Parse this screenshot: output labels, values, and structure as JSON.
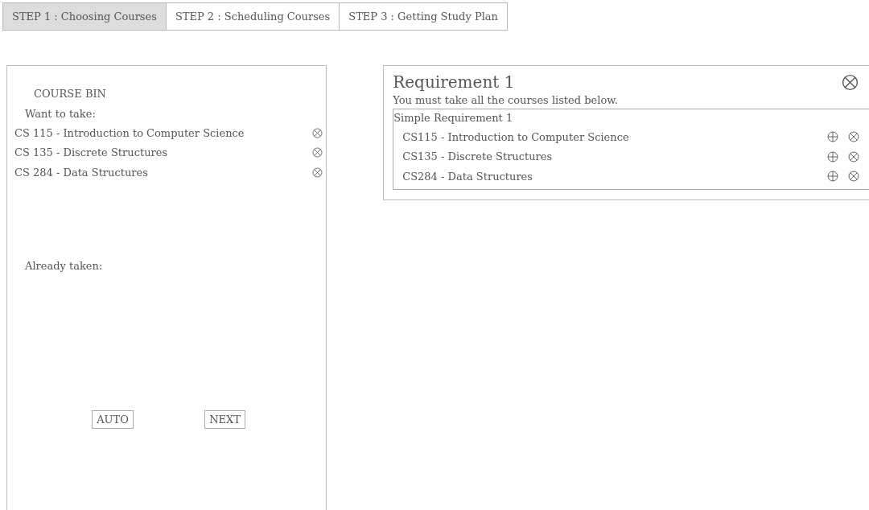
{
  "tabs": [
    {
      "label": "STEP 1 : Choosing Courses",
      "selected": true
    },
    {
      "label": "STEP 2 : Scheduling Courses",
      "selected": false
    },
    {
      "label": "STEP 3 : Getting Study Plan",
      "selected": false
    }
  ],
  "course_bin": {
    "title": "COURSE BIN",
    "want_label": "Want to take:",
    "want_courses": [
      "CS 115 - Introduction to Computer Science",
      "CS 135 - Discrete Structures",
      "CS 284 - Data Structures"
    ],
    "taken_label": "Already taken:",
    "buttons": [
      "AUTO",
      "NEXT"
    ]
  },
  "requirement": {
    "title": "Requirement 1",
    "description": "You must take all the courses listed below.",
    "group": {
      "title": "Simple Requirement 1",
      "courses": [
        "CS115 - Introduction to Computer Science",
        "CS135 - Discrete Structures",
        "CS284 - Data Structures"
      ]
    }
  }
}
